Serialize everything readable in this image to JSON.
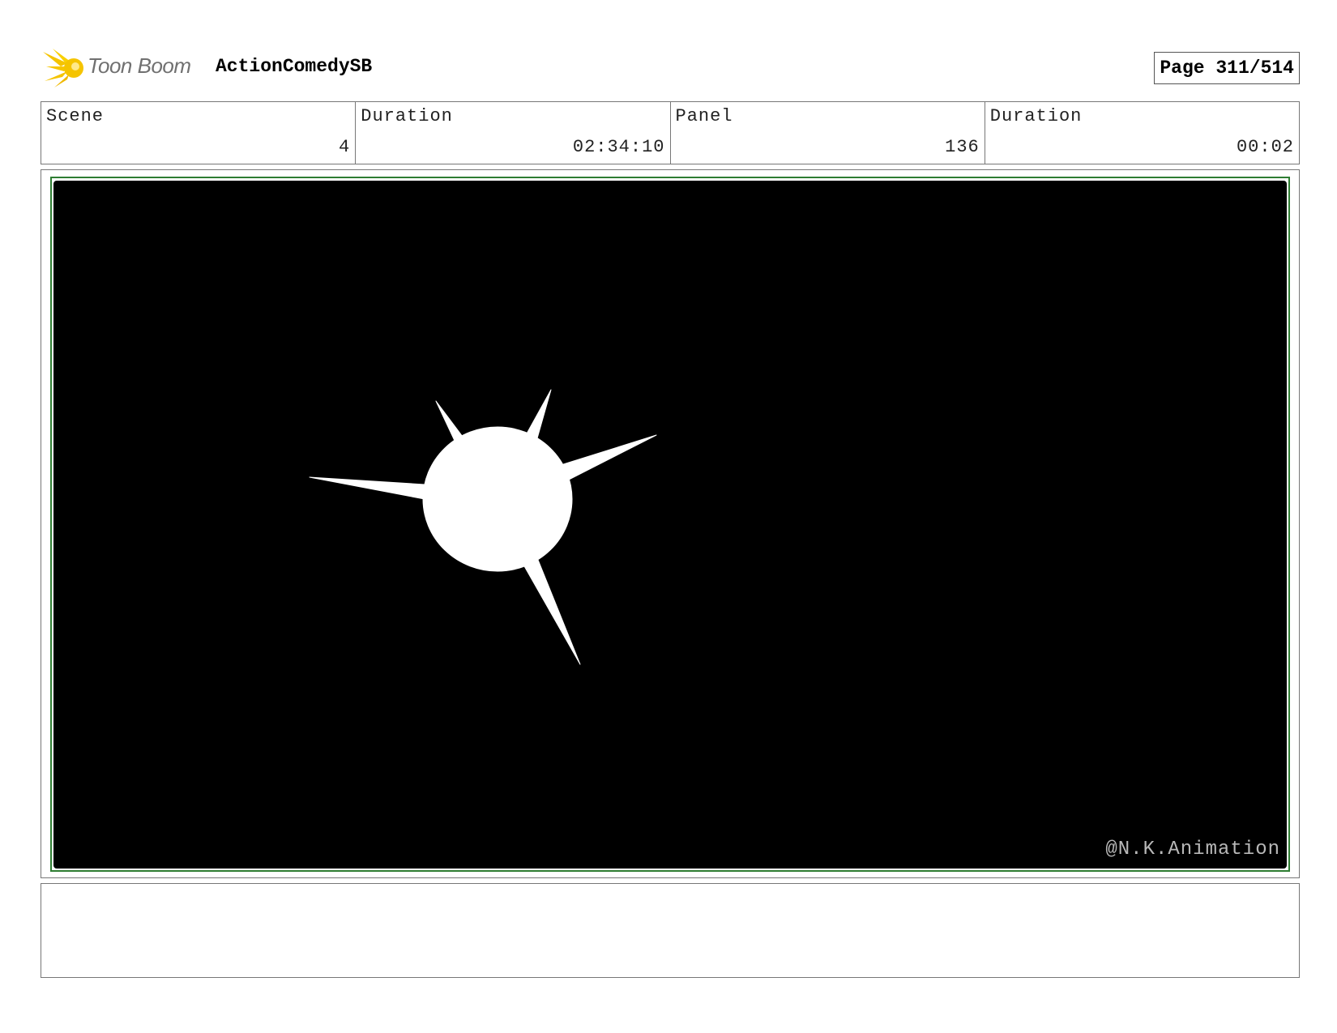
{
  "header": {
    "brand": "Toon Boom",
    "project_title": "ActionComedySB",
    "page_label": "Page 311/514"
  },
  "info": [
    {
      "label": "Scene",
      "value": "4"
    },
    {
      "label": "Duration",
      "value": "02:34:10"
    },
    {
      "label": "Panel",
      "value": "136"
    },
    {
      "label": "Duration",
      "value": "00:02"
    }
  ],
  "panel": {
    "watermark": "@N.K.Animation",
    "frame_color": "#2e7d32",
    "background_color": "#000000",
    "drawing_color": "#ffffff"
  },
  "notes": {
    "text": ""
  },
  "logo": {
    "icon": "toon-boom-starburst-icon",
    "color": "#f5c400"
  }
}
